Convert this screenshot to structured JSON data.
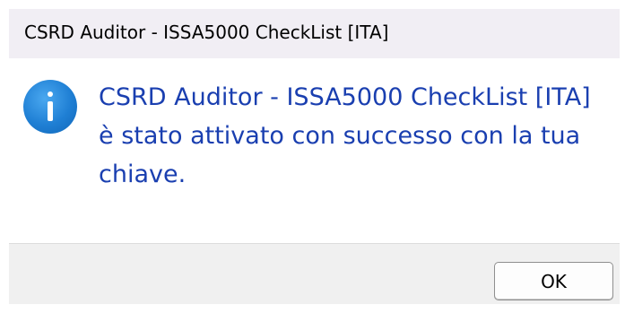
{
  "window": {
    "title": "CSRD Auditor - ISSA5000 CheckList [ITA]"
  },
  "message": {
    "lines": [
      "CSRD Auditor - ISSA5000 CheckList [ITA]",
      "è stato attivato con successo con la tua",
      "chiave."
    ],
    "icon": "info-icon"
  },
  "buttons": {
    "ok_label": "OK"
  },
  "colors": {
    "message_text": "#1a3fb0",
    "title_bar": "#f1eef4",
    "footer": "#f0f0f0",
    "icon_blue": "#1f7fd4"
  }
}
